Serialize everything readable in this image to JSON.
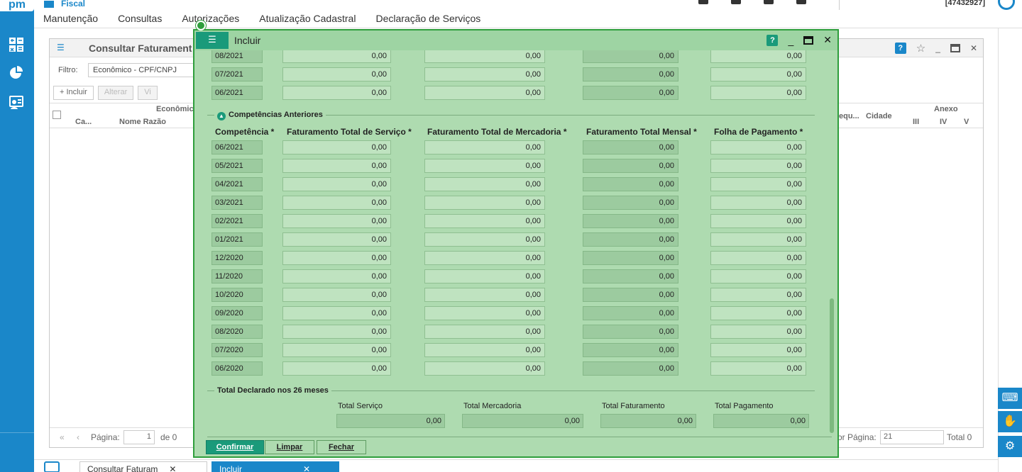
{
  "app": {
    "logo": "pm",
    "module": "Fiscal",
    "user_code": "[47432927]"
  },
  "menu": [
    "Manutenção",
    "Consultas",
    "Autorizações",
    "Atualização Cadastral",
    "Declaração de Serviços"
  ],
  "background_window": {
    "title": "Consultar Faturament",
    "filter_label": "Filtro:",
    "filter_value": "Econômico - CPF/CNPJ",
    "toolbar": {
      "incluir": "+ Incluir",
      "alterar": "Alterar",
      "visualizar": "Vi"
    },
    "grid": {
      "group_header": "Econômic",
      "col_ca": "Ca...",
      "col_nome": "Nome Razão",
      "col_sequ": "equ...",
      "col_cidade": "Cidade",
      "col_anexo": "Anexo",
      "anexo_cols": [
        "III",
        "IV",
        "V"
      ]
    },
    "pager": {
      "label": "Página:",
      "value": "1",
      "of": "de 0",
      "per_page_label": "or Página:",
      "per_page": "21",
      "total": "Total 0"
    }
  },
  "modal": {
    "title": "Incluir",
    "top_rows": [
      {
        "competencia": "08/2021",
        "servico": "0,00",
        "mercadoria": "0,00",
        "mensal": "0,00",
        "folha": "0,00"
      },
      {
        "competencia": "07/2021",
        "servico": "0,00",
        "mercadoria": "0,00",
        "mensal": "0,00",
        "folha": "0,00"
      },
      {
        "competencia": "06/2021",
        "servico": "0,00",
        "mercadoria": "0,00",
        "mensal": "0,00",
        "folha": "0,00"
      }
    ],
    "section_anteriores": "Competências Anteriores",
    "headers": {
      "competencia": "Competência *",
      "servico": "Faturamento Total de Serviço *",
      "mercadoria": "Faturamento Total de Mercadoria *",
      "mensal": "Faturamento Total Mensal *",
      "folha": "Folha de Pagamento *"
    },
    "rows": [
      {
        "competencia": "06/2021",
        "servico": "0,00",
        "mercadoria": "0,00",
        "mensal": "0,00",
        "folha": "0,00"
      },
      {
        "competencia": "05/2021",
        "servico": "0,00",
        "mercadoria": "0,00",
        "mensal": "0,00",
        "folha": "0,00"
      },
      {
        "competencia": "04/2021",
        "servico": "0,00",
        "mercadoria": "0,00",
        "mensal": "0,00",
        "folha": "0,00"
      },
      {
        "competencia": "03/2021",
        "servico": "0,00",
        "mercadoria": "0,00",
        "mensal": "0,00",
        "folha": "0,00"
      },
      {
        "competencia": "02/2021",
        "servico": "0,00",
        "mercadoria": "0,00",
        "mensal": "0,00",
        "folha": "0,00"
      },
      {
        "competencia": "01/2021",
        "servico": "0,00",
        "mercadoria": "0,00",
        "mensal": "0,00",
        "folha": "0,00"
      },
      {
        "competencia": "12/2020",
        "servico": "0,00",
        "mercadoria": "0,00",
        "mensal": "0,00",
        "folha": "0,00"
      },
      {
        "competencia": "11/2020",
        "servico": "0,00",
        "mercadoria": "0,00",
        "mensal": "0,00",
        "folha": "0,00"
      },
      {
        "competencia": "10/2020",
        "servico": "0,00",
        "mercadoria": "0,00",
        "mensal": "0,00",
        "folha": "0,00"
      },
      {
        "competencia": "09/2020",
        "servico": "0,00",
        "mercadoria": "0,00",
        "mensal": "0,00",
        "folha": "0,00"
      },
      {
        "competencia": "08/2020",
        "servico": "0,00",
        "mercadoria": "0,00",
        "mensal": "0,00",
        "folha": "0,00"
      },
      {
        "competencia": "07/2020",
        "servico": "0,00",
        "mercadoria": "0,00",
        "mensal": "0,00",
        "folha": "0,00"
      },
      {
        "competencia": "06/2020",
        "servico": "0,00",
        "mercadoria": "0,00",
        "mensal": "0,00",
        "folha": "0,00"
      }
    ],
    "section_total": "Total Declarado nos 26 meses",
    "totals": {
      "servico_label": "Total Serviço",
      "servico": "0,00",
      "mercadoria_label": "Total Mercadoria",
      "mercadoria": "0,00",
      "faturamento_label": "Total Faturamento",
      "faturamento": "0,00",
      "pagamento_label": "Total Pagamento",
      "pagamento": "0,00"
    },
    "buttons": {
      "confirmar": "Confirmar",
      "limpar": "Limpar",
      "fechar": "Fechar"
    }
  },
  "taskbar": [
    {
      "label": "Consultar Faturam",
      "close": "✕"
    },
    {
      "label": "Incluir",
      "close": "✕"
    }
  ],
  "colors": {
    "brand": "#1a87c9",
    "modal_bg": "#aedbb0",
    "modal_border": "#2e9e3c",
    "accent_teal": "#1a9a7a"
  }
}
